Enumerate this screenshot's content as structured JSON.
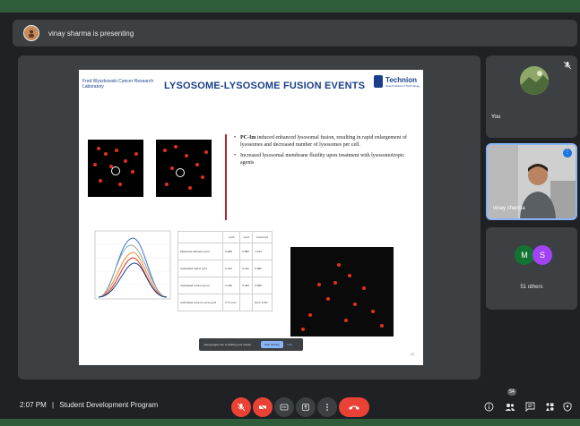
{
  "presenting": {
    "text": "vinay sharma is presenting"
  },
  "slide": {
    "lab_name": "Fred Wyszkowski Cancer Research Laboratory",
    "title": "LYSOSOME-LYSOSOME FUSION EVENTS",
    "logo_name": "Technion",
    "logo_sub": "Israel Institute of Technology",
    "bullets": [
      {
        "bold": "PC-Im",
        "text": " induced enhanced lysosomal fusion, resulting in rapid enlargement of lysosomes and decreased number of lysosomes per cell."
      },
      {
        "bold": "",
        "text": "Increased lysosomal membrane fluidity upon treatment with lysosomotropic agents"
      }
    ],
    "table": {
      "headers": [
        "",
        "Lyo1",
        "Lyo2",
        "Fused lys"
      ],
      "rows": [
        [
          "Measured diameter (μm)",
          "0.883",
          "0.883",
          "1.164"
        ],
        [
          "Calculated radius (μm)",
          "0.441",
          "0.441",
          "0.582"
        ],
        [
          "Calculated volume (μm³)",
          "0.360",
          "0.360",
          "0.826"
        ],
        [
          "Calculated volume Lyo1+Lyo2",
          "0.72 μm³",
          "",
          "Error 0.4%"
        ]
      ]
    },
    "toast": {
      "text": "meet.google.com is sharing your screen.",
      "stop_label": "Stop sharing",
      "hide_label": "Hide"
    },
    "page_number": "22"
  },
  "participants": {
    "you_label": "You",
    "presenter_label": "vinay sharma",
    "others_initials": [
      "M",
      "S"
    ],
    "others_text": "51 others"
  },
  "bottom_bar": {
    "time": "2:07 PM",
    "separator": "|",
    "meeting_name": "Student Development Program",
    "people_count": "54"
  },
  "colors": {
    "accent_red": "#ea4335",
    "panel": "#3c4043",
    "background": "#202124",
    "border_green": "#2f5d3a"
  }
}
